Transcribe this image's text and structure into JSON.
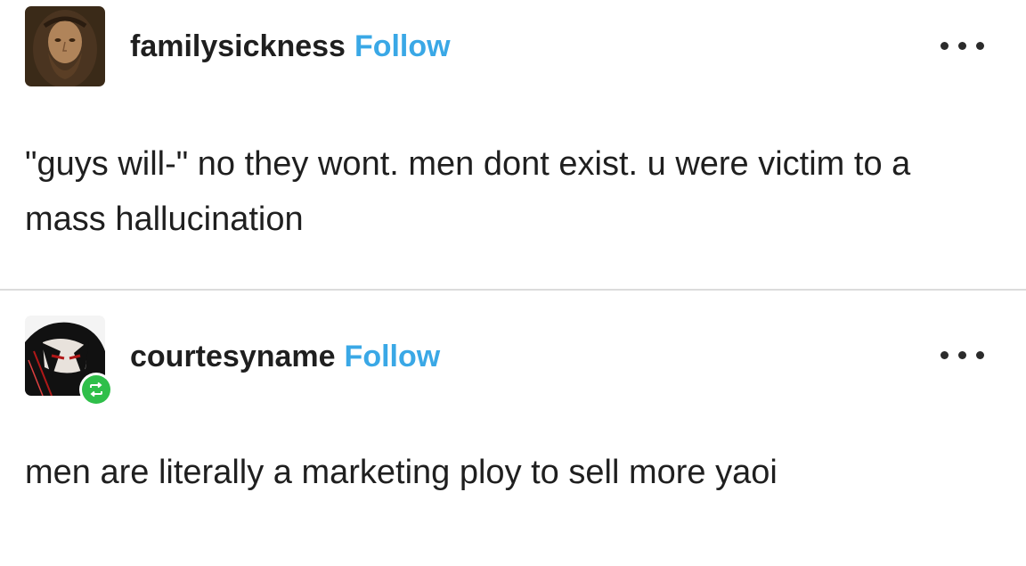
{
  "posts": [
    {
      "username": "familysickness",
      "follow_label": "Follow",
      "avatar_icon": "portrait-avatar",
      "text": "\"guys will-\" no they wont. men dont exist. u were victim to a mass hallucination"
    },
    {
      "username": "courtesyname",
      "follow_label": "Follow",
      "avatar_icon": "anime-avatar",
      "reblog_icon": "reblog-icon",
      "text": "men are literally a marketing ploy to sell more yaoi"
    }
  ],
  "colors": {
    "follow": "#3aa8e6",
    "reblog_badge": "#2fbf4a",
    "divider": "#dcdcdc",
    "text": "#1f1f1f"
  }
}
